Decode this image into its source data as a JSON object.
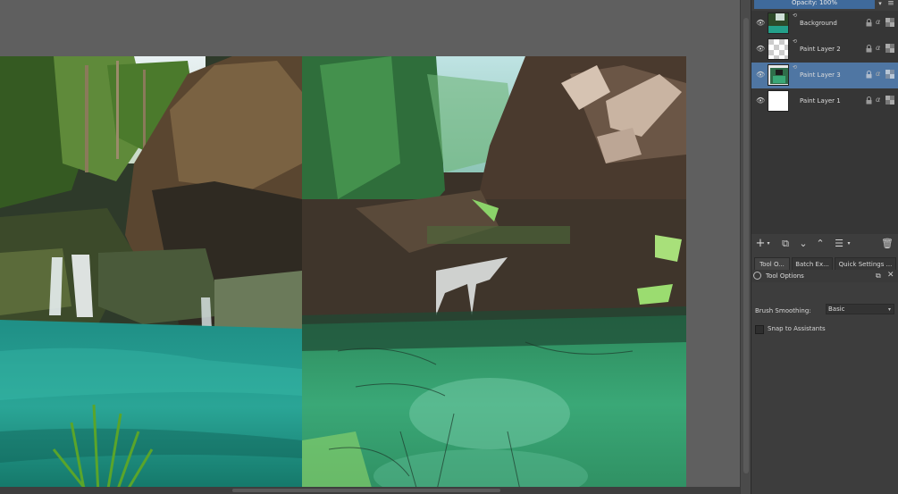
{
  "layers_panel": {
    "opacity_label": "Opacity:  100%",
    "layers": [
      {
        "name": "Background",
        "active": false,
        "thumb": "photo"
      },
      {
        "name": "Paint Layer 2",
        "active": false,
        "thumb": "transparent"
      },
      {
        "name": "Paint Layer 3",
        "active": true,
        "thumb": "paint"
      },
      {
        "name": "Paint Layer 1",
        "active": false,
        "thumb": "white"
      }
    ],
    "toolbar_icons": [
      "add-layer-icon",
      "duplicate-layer-icon",
      "move-layer-down-icon",
      "move-layer-up-icon",
      "layer-properties-icon",
      "delete-layer-icon"
    ]
  },
  "dock_tabs": [
    {
      "label": "Tool O...",
      "active": true
    },
    {
      "label": "Batch Ex...",
      "active": false
    },
    {
      "label": "Quick Settings ...",
      "active": false
    }
  ],
  "tool_options": {
    "title": "Tool Options",
    "brush_smoothing_label": "Brush Smoothing:",
    "brush_smoothing_value": "Basic",
    "snap_label": "Snap to Assistants",
    "snap_checked": false
  },
  "colors": {
    "accent": "#4f76a3",
    "canvas_bg": "#5f5f5f",
    "panel_bg": "#3d3d3d"
  }
}
